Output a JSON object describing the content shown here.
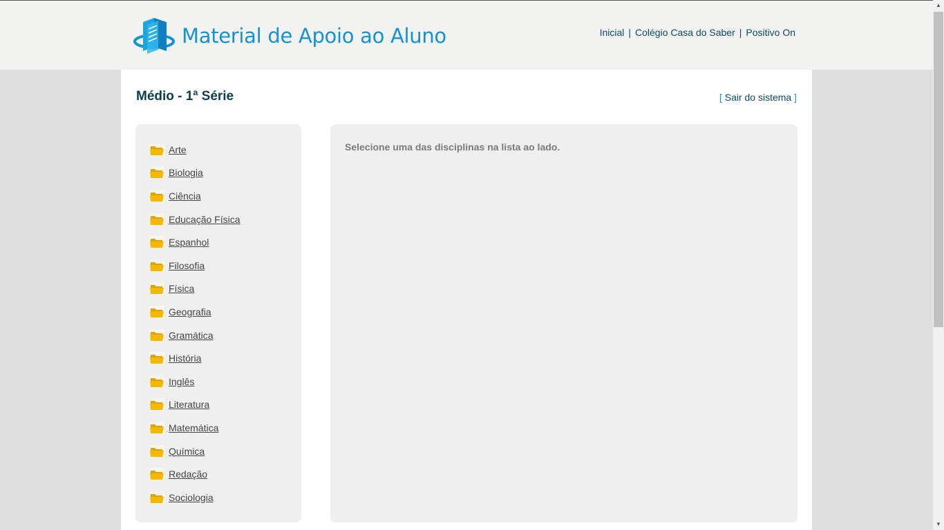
{
  "header": {
    "logo_text": "Material de Apoio ao Aluno",
    "nav": [
      {
        "label": "Inicial"
      },
      {
        "label": "Colégio Casa do Saber"
      },
      {
        "label": "Positivo On"
      }
    ],
    "separator": "|"
  },
  "page": {
    "title": "Médio - 1ª Série",
    "logout_open": "[",
    "logout_label": "Sair do sistema",
    "logout_close": "]"
  },
  "subjects": [
    {
      "label": "Arte"
    },
    {
      "label": "Biologia"
    },
    {
      "label": "Ciência"
    },
    {
      "label": "Educação Física"
    },
    {
      "label": "Espanhol"
    },
    {
      "label": "Filosofia"
    },
    {
      "label": "Física"
    },
    {
      "label": "Geografia"
    },
    {
      "label": "Gramática"
    },
    {
      "label": "História"
    },
    {
      "label": "Inglês"
    },
    {
      "label": "Literatura"
    },
    {
      "label": "Matemática"
    },
    {
      "label": "Química"
    },
    {
      "label": "Redação"
    },
    {
      "label": "Sociologia"
    }
  ],
  "main": {
    "message": "Selecione uma das disciplinas na lista ao lado."
  },
  "icons": {
    "subject_icon": "folder-icon",
    "logo_icon": "books-icon"
  },
  "colors": {
    "brand": "#1592d0",
    "nav_text": "#0b4a63",
    "folder": "#f5b800"
  }
}
